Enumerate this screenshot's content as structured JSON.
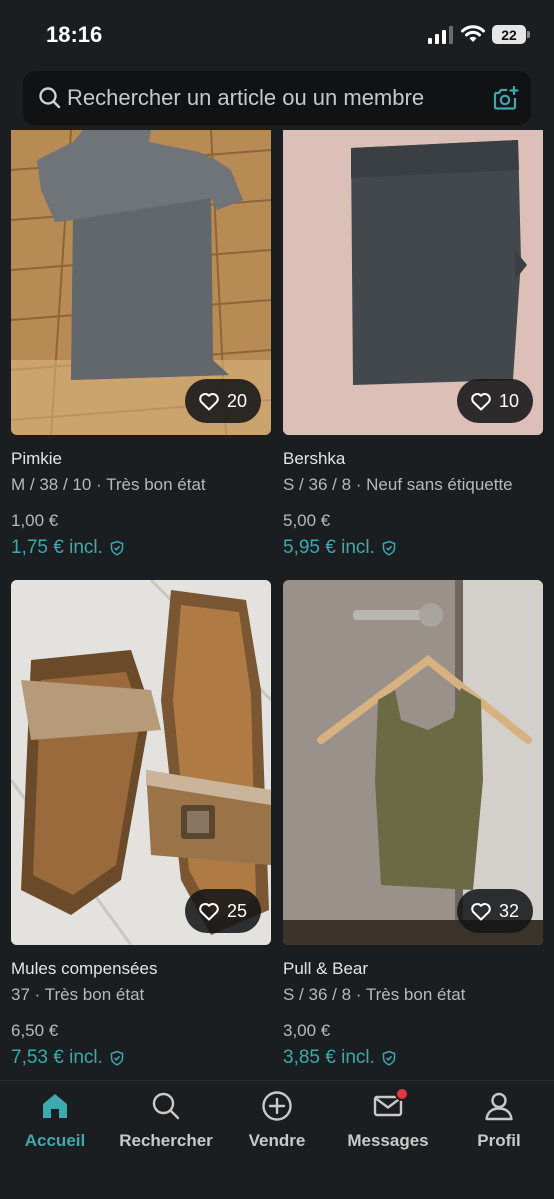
{
  "status": {
    "time": "18:16",
    "battery": "22"
  },
  "search": {
    "placeholder": "Rechercher un article ou un membre"
  },
  "items": [
    {
      "brand": "Pimkie",
      "details": "M / 38 / 10 · Très bon état",
      "price": "1,00 €",
      "price_incl": "1,75 € incl.",
      "likes": "20",
      "image": "gray-tshirt"
    },
    {
      "brand": "Bershka",
      "details": "S / 36 / 8 · Neuf sans étiquette",
      "price": "5,00 €",
      "price_incl": "5,95 € incl.",
      "likes": "10",
      "image": "gray-skirt"
    },
    {
      "brand": "Mules compensées",
      "details": "37 · Très bon état",
      "price": "6,50 €",
      "price_incl": "7,53 € incl.",
      "likes": "25",
      "image": "wedge-mules"
    },
    {
      "brand": "Pull & Bear",
      "details": "S / 36 / 8 · Très bon état",
      "price": "3,00 €",
      "price_incl": "3,85 € incl.",
      "likes": "32",
      "image": "khaki-tank-top"
    }
  ],
  "tabs": [
    {
      "label": "Accueil",
      "icon": "home-icon",
      "active": true
    },
    {
      "label": "Rechercher",
      "icon": "search-icon",
      "active": false
    },
    {
      "label": "Vendre",
      "icon": "plus-circle-icon",
      "active": false
    },
    {
      "label": "Messages",
      "icon": "mail-icon",
      "active": false,
      "badge": true
    },
    {
      "label": "Profil",
      "icon": "profile-icon",
      "active": false
    }
  ],
  "colors": {
    "accent": "#3fa7ae",
    "background": "#1b1e21",
    "badge": "#e4363f"
  }
}
